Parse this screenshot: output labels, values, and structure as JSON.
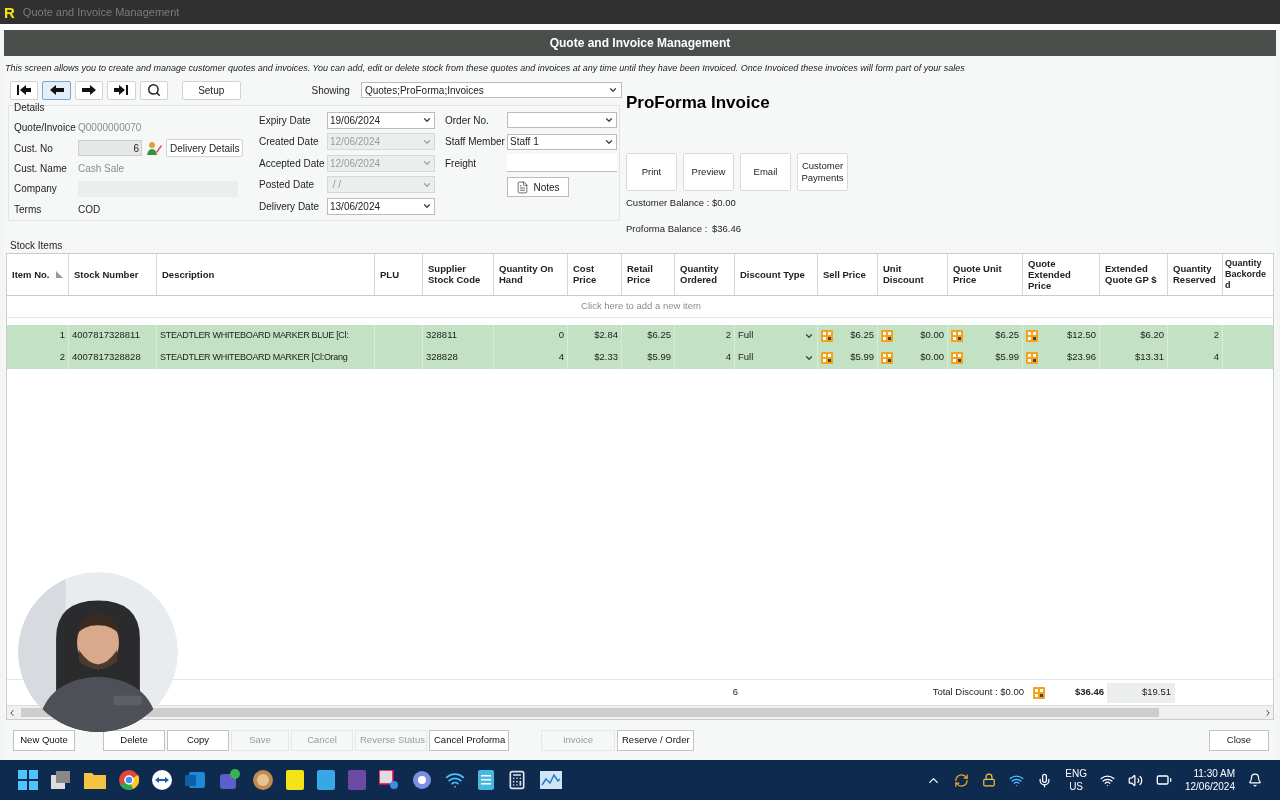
{
  "window": {
    "logo": "R",
    "title": "Quote and Invoice Management"
  },
  "header": {
    "title": "Quote and Invoice Management"
  },
  "description": "This screen allows you to create and manage customer quotes and invoices.  You can add, edit or delete stock from these quotes and invoices at any time until they have been Invoiced.  Once Invoiced these invoices will form part of your sales",
  "toolbar": {
    "nav": [
      {
        "kind": "first",
        "selected": false
      },
      {
        "kind": "prev",
        "selected": true
      },
      {
        "kind": "next",
        "selected": false
      },
      {
        "kind": "last",
        "selected": false
      },
      {
        "kind": "search",
        "selected": false
      }
    ],
    "setup": "Setup",
    "showing_label": "Showing",
    "showing_value": "Quotes;ProForma;Invoices"
  },
  "document_title": "ProForma Invoice",
  "details": {
    "title": "Details",
    "col1": [
      {
        "label": "Quote/Invoice",
        "kind": "static",
        "value": "Q0000000070",
        "disabled": true
      },
      {
        "label": "Cust. No",
        "kind": "custno",
        "value": "6",
        "disabled": true,
        "button": "Delivery Details"
      },
      {
        "label": "Cust. Name",
        "kind": "static",
        "value": "Cash Sale",
        "disabled": true
      },
      {
        "label": "Company",
        "kind": "static",
        "disabled": true
      },
      {
        "label": "Terms",
        "kind": "static",
        "value": "COD",
        "disabled": false
      }
    ],
    "col2": [
      {
        "label": "Expiry Date",
        "value": "19/06/2024",
        "disabled": false
      },
      {
        "label": "Created Date",
        "value": "12/06/2024",
        "disabled": true
      },
      {
        "label": "Accepted Date",
        "value": "12/06/2024",
        "disabled": true
      },
      {
        "label": "Posted Date",
        "value": " / /",
        "disabled": true
      },
      {
        "label": "Delivery Date",
        "value": "13/06/2024",
        "disabled": false
      }
    ],
    "col3": [
      {
        "label": "Order No.",
        "kind": "dropdown"
      },
      {
        "label": "Staff Member",
        "kind": "dropdown",
        "value": "Staff 1"
      },
      {
        "label": "Freight",
        "kind": "input"
      }
    ],
    "notes": "Notes"
  },
  "actions": [
    {
      "label": "Print"
    },
    {
      "label": "Preview"
    },
    {
      "label": "Email"
    },
    {
      "label": "Customer Payments"
    }
  ],
  "balances": [
    {
      "label": "Customer Balance :",
      "value": "$0.00"
    },
    {
      "label": "Proforma Balance :",
      "value": "$36.46"
    }
  ],
  "stock_items": {
    "title": "Stock Items",
    "columns": [
      {
        "label": "Item No.",
        "kind": "num",
        "sorted": true
      },
      {
        "label": "Stock Number",
        "kind": "text"
      },
      {
        "label": "Description",
        "kind": "text"
      },
      {
        "label": "PLU",
        "kind": "text"
      },
      {
        "label": "Supplier Stock Code",
        "kind": "text"
      },
      {
        "label": "Quantity On Hand",
        "kind": "num"
      },
      {
        "label": "Cost Price",
        "kind": "num"
      },
      {
        "label": "Retail Price",
        "kind": "num"
      },
      {
        "label": "Quantity Ordered",
        "kind": "num"
      },
      {
        "label": "Discount Type",
        "kind": "dropdown"
      },
      {
        "label": "Sell Price",
        "kind": "calc"
      },
      {
        "label": "Unit Discount",
        "kind": "calc"
      },
      {
        "label": "Quote Unit Price",
        "kind": "calc"
      },
      {
        "label": "Quote Extended Price",
        "kind": "calc"
      },
      {
        "label": "Extended Quote GP $",
        "kind": "num"
      },
      {
        "label": "Quantity Reserved",
        "kind": "num"
      },
      {
        "label": "Quantity Backorde d",
        "kind": "num"
      }
    ],
    "add_row": "Click here to add a new item",
    "rows": [
      {
        "selected": true,
        "cells": [
          "1",
          "4007817328811",
          "STEADTLER WHITEBOARD MARKER BLUE [Cl:",
          "",
          "328811",
          "0",
          "$2.84",
          "$6.25",
          "2",
          "Full",
          "$6.25",
          "$0.00",
          "$6.25",
          "$12.50",
          "$6.20",
          "2",
          ""
        ]
      },
      {
        "selected": true,
        "cells": [
          "2",
          "4007817328828",
          "STEADTLER WHITEBOARD MARKER [Cl:Orang",
          "",
          "328828",
          "4",
          "$2.33",
          "$5.99",
          "4",
          "Full",
          "$5.99",
          "$0.00",
          "$5.99",
          "$23.96",
          "$13.31",
          "4",
          ""
        ]
      }
    ],
    "totals": {
      "quantity_ordered": "6",
      "total_discount": "Total Discount : $0.00",
      "quote_extended": "$36.46",
      "extended_gp": "$19.51"
    }
  },
  "buttons": [
    {
      "label": "New Quote",
      "disabled": false
    },
    {
      "label": "Delete",
      "disabled": false
    },
    {
      "label": "Copy",
      "disabled": false
    },
    {
      "label": "Save",
      "disabled": true
    },
    {
      "label": "Cancel",
      "disabled": true
    },
    {
      "label": "Reverse Status",
      "disabled": true
    },
    {
      "label": "Cancel Proforma",
      "disabled": false
    },
    {
      "label": "Invoice",
      "disabled": true
    },
    {
      "label": "Reserve / Order",
      "disabled": false
    }
  ],
  "close_button": "Close",
  "taskbar": {
    "language": "ENG",
    "region": "US",
    "time": "11:30 AM",
    "date": "12/06/2024"
  }
}
